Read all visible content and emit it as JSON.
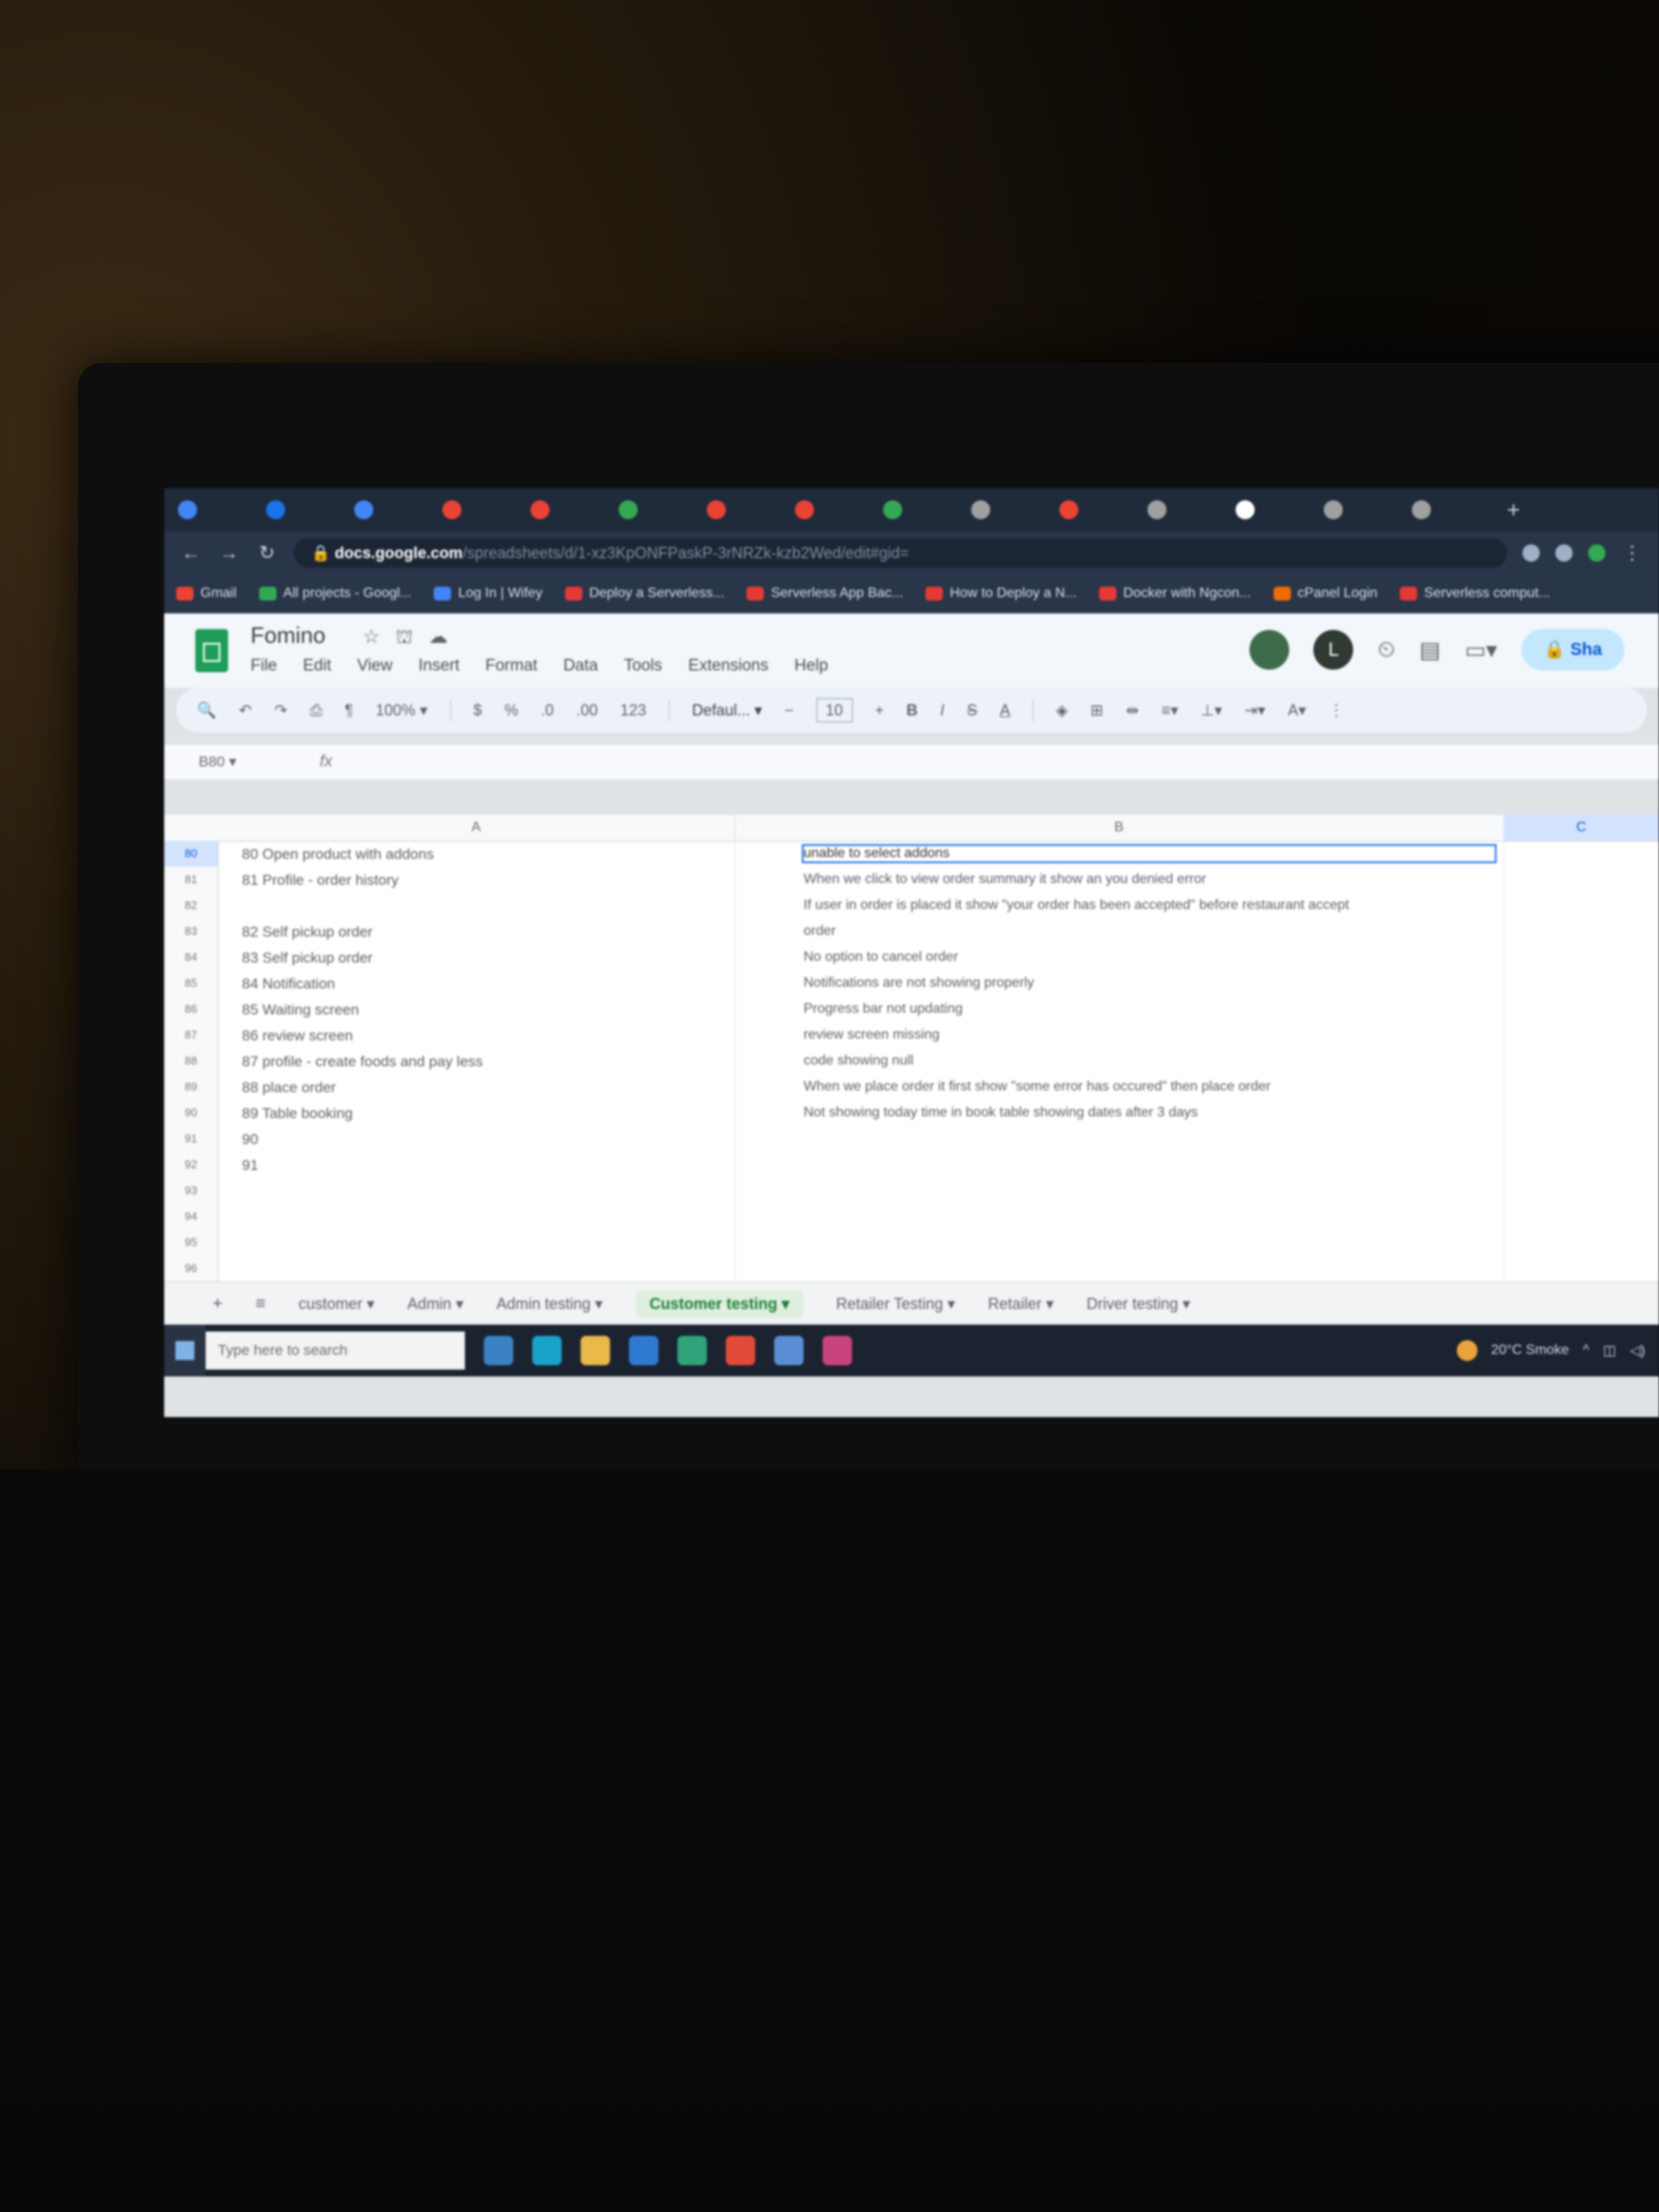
{
  "browser": {
    "url_host": "docs.google.com",
    "url_rest": "/spreadsheets/d/1-xz3KpONFPaskP-3rNRZk-kzb2Wed/edit#gid=",
    "bookmarks": [
      {
        "label": "Gmail",
        "color": "#ea4335"
      },
      {
        "label": "All projects - Googl...",
        "color": "#34a853"
      },
      {
        "label": "Log In | Wifey",
        "color": "#4285f4"
      },
      {
        "label": "Deploy a Serverless...",
        "color": "#e53935"
      },
      {
        "label": "Serverless App Bac...",
        "color": "#e53935"
      },
      {
        "label": "How to Deploy a N...",
        "color": "#e53935"
      },
      {
        "label": "Docker with Ngcon...",
        "color": "#e53935"
      },
      {
        "label": "cPanel Login",
        "color": "#ef6c00"
      },
      {
        "label": "Serverless comput...",
        "color": "#e53935"
      }
    ],
    "tab_favicon_colors": [
      "#4285f4",
      "#1a73e8",
      "#4285f4",
      "#ea4335",
      "#ea4335",
      "#34a853",
      "#ea4335",
      "#ea4335",
      "#34a853",
      "#a0a0a0",
      "#ea4335",
      "#a0a0a0",
      "#ffffff",
      "#a0a0a0",
      "#a0a0a0"
    ]
  },
  "sheets": {
    "doc_title": "Fomino",
    "menu": [
      "File",
      "Edit",
      "View",
      "Insert",
      "Format",
      "Data",
      "Tools",
      "Extensions",
      "Help"
    ],
    "share_label": "Sha",
    "avatar_initial": "L",
    "toolbar": {
      "zoom": "100%",
      "font": "Defaul...",
      "font_size": "10"
    },
    "namebox": "B80",
    "formula": "",
    "columns": [
      "A",
      "B",
      "C"
    ],
    "rows": [
      {
        "num": "80",
        "a": "80  Open product with addons",
        "b": "unable to select addons",
        "selected": true
      },
      {
        "num": "81",
        "a": "81  Profile - order history",
        "b": "When we click to view order summary it show an you denied error"
      },
      {
        "num": "82",
        "a": "",
        "b": "If user in order is placed it show \"your order has been accepted\" before restaurant accept"
      },
      {
        "num": "83",
        "a": "82  Self pickup order",
        "b": "order"
      },
      {
        "num": "84",
        "a": "83  Self pickup order",
        "b": "No option to cancel order"
      },
      {
        "num": "85",
        "a": "84  Notification",
        "b": "Notifications are not showing properly"
      },
      {
        "num": "86",
        "a": "85  Waiting screen",
        "b": "Progress bar not updating"
      },
      {
        "num": "87",
        "a": "86  review screen",
        "b": "review screen missing"
      },
      {
        "num": "88",
        "a": "87  profile - create foods and pay less",
        "b": "code showing null"
      },
      {
        "num": "89",
        "a": "88  place order",
        "b": "When we place order it first show \"some error has occured\" then place order"
      },
      {
        "num": "90",
        "a": "89  Table booking",
        "b": "Not showing today time in book table showing dates after 3 days"
      },
      {
        "num": "91",
        "a": "90",
        "b": ""
      },
      {
        "num": "92",
        "a": "91",
        "b": ""
      },
      {
        "num": "93",
        "a": "",
        "b": ""
      },
      {
        "num": "94",
        "a": "",
        "b": ""
      },
      {
        "num": "95",
        "a": "",
        "b": ""
      },
      {
        "num": "96",
        "a": "",
        "b": ""
      }
    ],
    "sheet_tabs": [
      "customer",
      "Admin",
      "Admin testing",
      "Customer testing",
      "Retailer Testing",
      "Retailer",
      "Driver testing"
    ],
    "active_sheet": "Customer testing"
  },
  "taskbar": {
    "search_placeholder": "Type here to search",
    "weather": "20°C Smoke",
    "app_colors": [
      "#3b82c4",
      "#1aa3c9",
      "#e9b949",
      "#2f7ad1",
      "#2fa37a",
      "#e04b3a",
      "#5a8fd6",
      "#c9447e"
    ]
  },
  "colors": {
    "sheets_green": "#1e9e58",
    "selection_blue": "#1a73e8",
    "active_tab_green": "#188038"
  }
}
